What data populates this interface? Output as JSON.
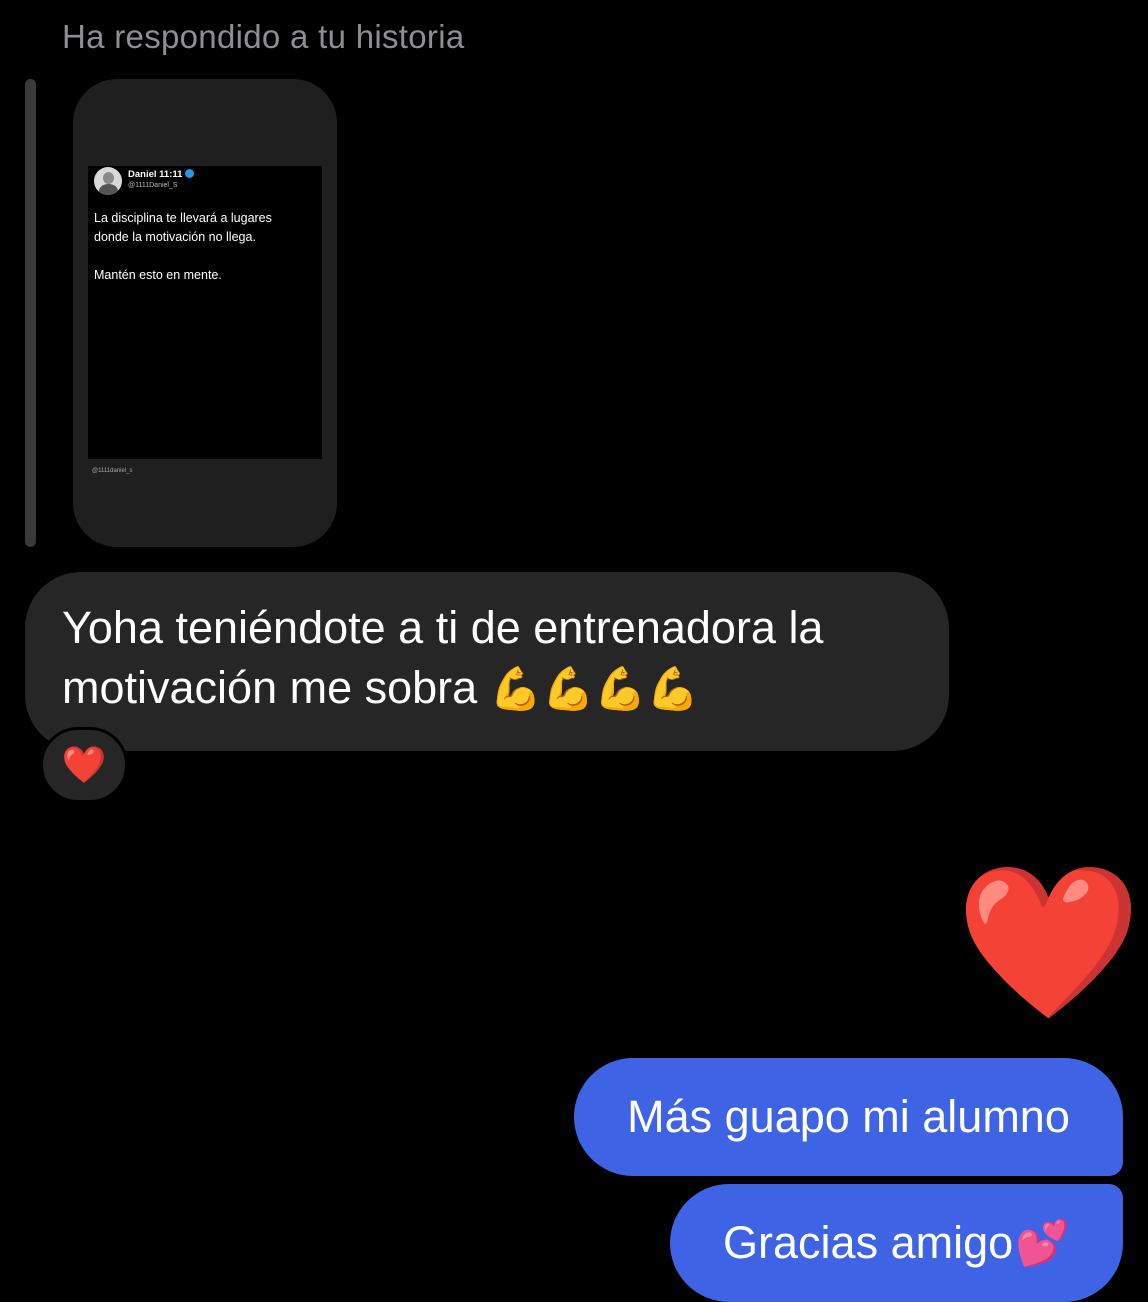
{
  "thread": {
    "reply_note": "Ha respondido a tu historia",
    "story": {
      "tweet_author": "Daniel 11:11",
      "tweet_handle": "@1111Daniel_S",
      "tweet_line1": "La disciplina te llevará a lugares donde la motivación no llega.",
      "tweet_line2": "Mantén esto en mente.",
      "watermark": "@1111daniel_s"
    },
    "incoming": {
      "text": "Yoha teniéndote a ti  de entrenadora la motivación me sobra",
      "emoji": "💪💪💪💪",
      "reaction": "❤️"
    },
    "outgoing": {
      "sticker": "❤️",
      "message1": "Más guapo mi alumno",
      "message2": "Gracias amigo",
      "message2_emoji": "💕"
    }
  },
  "colors": {
    "background": "#000000",
    "incoming_bubble": "#262626",
    "outgoing_bubble": "#3e64e5",
    "meta_text": "#8e8e93"
  },
  "icons": [
    "verified-badge-icon",
    "avatar-icon",
    "red-heart-icon",
    "flexed-biceps-icon",
    "two-hearts-icon"
  ]
}
